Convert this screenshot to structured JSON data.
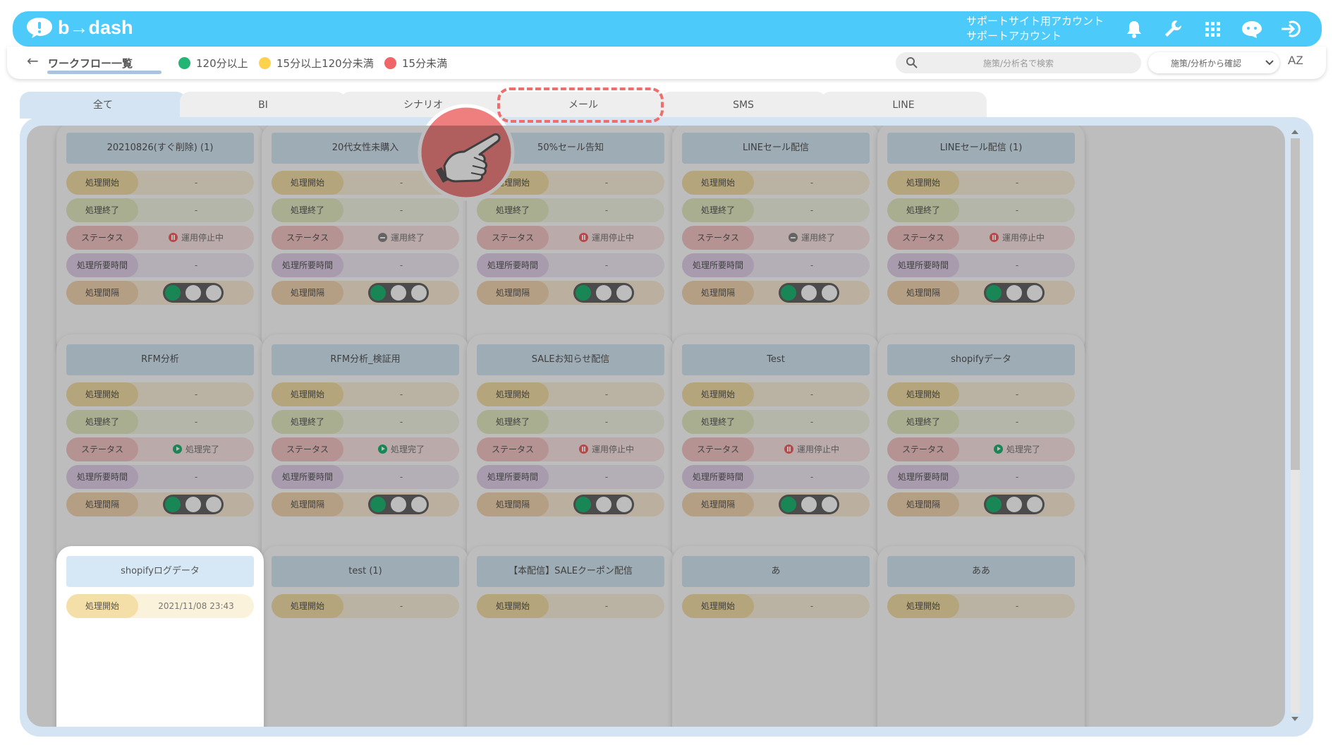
{
  "header": {
    "logo_text": "b→dash",
    "account_line1": "サポートサイト用アカウント",
    "account_line2": "サポートアカウント",
    "icons": [
      "bell-icon",
      "wrench-icon",
      "grid-icon",
      "chat-bot-icon",
      "logout-icon"
    ]
  },
  "subheader": {
    "back_icon": "←",
    "breadcrumb": "ワークフロー一覧",
    "legend": [
      {
        "label": "120分以上",
        "color": "#22b573"
      },
      {
        "label": "15分以上120分未満",
        "color": "#ffd24d"
      },
      {
        "label": "15分未満",
        "color": "#f06565"
      }
    ],
    "search_placeholder": "施策/分析名で検索",
    "select_value": "施策/分析から確認",
    "sort_label": "AZ"
  },
  "tabs": [
    {
      "label": "全て",
      "active": true
    },
    {
      "label": "BI",
      "active": false
    },
    {
      "label": "シナリオ",
      "active": false
    },
    {
      "label": "メール",
      "active": false
    },
    {
      "label": "SMS",
      "active": false
    },
    {
      "label": "LINE",
      "active": false
    }
  ],
  "row_labels": {
    "start": "処理開始",
    "end": "処理終了",
    "status": "ステータス",
    "duration": "処理所要時間",
    "interval": "処理間隔"
  },
  "status_colors": {
    "stopped": "#f06565",
    "ended": "#888888",
    "done": "#22b573"
  },
  "cards": [
    {
      "title": "20210826(すぐ削除) (1)",
      "start": "-",
      "end": "-",
      "status": "運用停止中",
      "status_type": "stopped",
      "duration": "-"
    },
    {
      "title": "20代女性未購入",
      "start": "-",
      "end": "-",
      "status": "運用終了",
      "status_type": "ended",
      "duration": "-"
    },
    {
      "title": "50%セール告知",
      "start": "-",
      "end": "-",
      "status": "運用停止中",
      "status_type": "stopped",
      "duration": "-"
    },
    {
      "title": "LINEセール配信",
      "start": "-",
      "end": "-",
      "status": "運用終了",
      "status_type": "ended",
      "duration": "-"
    },
    {
      "title": "LINEセール配信 (1)",
      "start": "-",
      "end": "-",
      "status": "運用停止中",
      "status_type": "stopped",
      "duration": "-"
    },
    {
      "title": "RFM分析",
      "start": "-",
      "end": "-",
      "status": "処理完了",
      "status_type": "done",
      "duration": "-"
    },
    {
      "title": "RFM分析_検証用",
      "start": "-",
      "end": "-",
      "status": "処理完了",
      "status_type": "done",
      "duration": "-"
    },
    {
      "title": "SALEお知らせ配信",
      "start": "-",
      "end": "-",
      "status": "運用停止中",
      "status_type": "stopped",
      "duration": "-"
    },
    {
      "title": "Test",
      "start": "-",
      "end": "-",
      "status": "運用停止中",
      "status_type": "stopped",
      "duration": "-"
    },
    {
      "title": "shopifyデータ",
      "start": "-",
      "end": "-",
      "status": "処理完了",
      "status_type": "done",
      "duration": "-"
    },
    {
      "title": "shopifyログデータ",
      "start": "2021/11/08 23:43",
      "end": "",
      "status": "",
      "status_type": "",
      "duration": ""
    },
    {
      "title": "test (1)",
      "start": "-",
      "end": "",
      "status": "",
      "status_type": "",
      "duration": ""
    },
    {
      "title": "【本配信】SALEクーポン配信",
      "start": "-",
      "end": "",
      "status": "",
      "status_type": "",
      "duration": ""
    },
    {
      "title": "あ",
      "start": "-",
      "end": "",
      "status": "",
      "status_type": "",
      "duration": ""
    },
    {
      "title": "ああ",
      "start": "-",
      "end": "",
      "status": "",
      "status_type": "",
      "duration": ""
    }
  ]
}
